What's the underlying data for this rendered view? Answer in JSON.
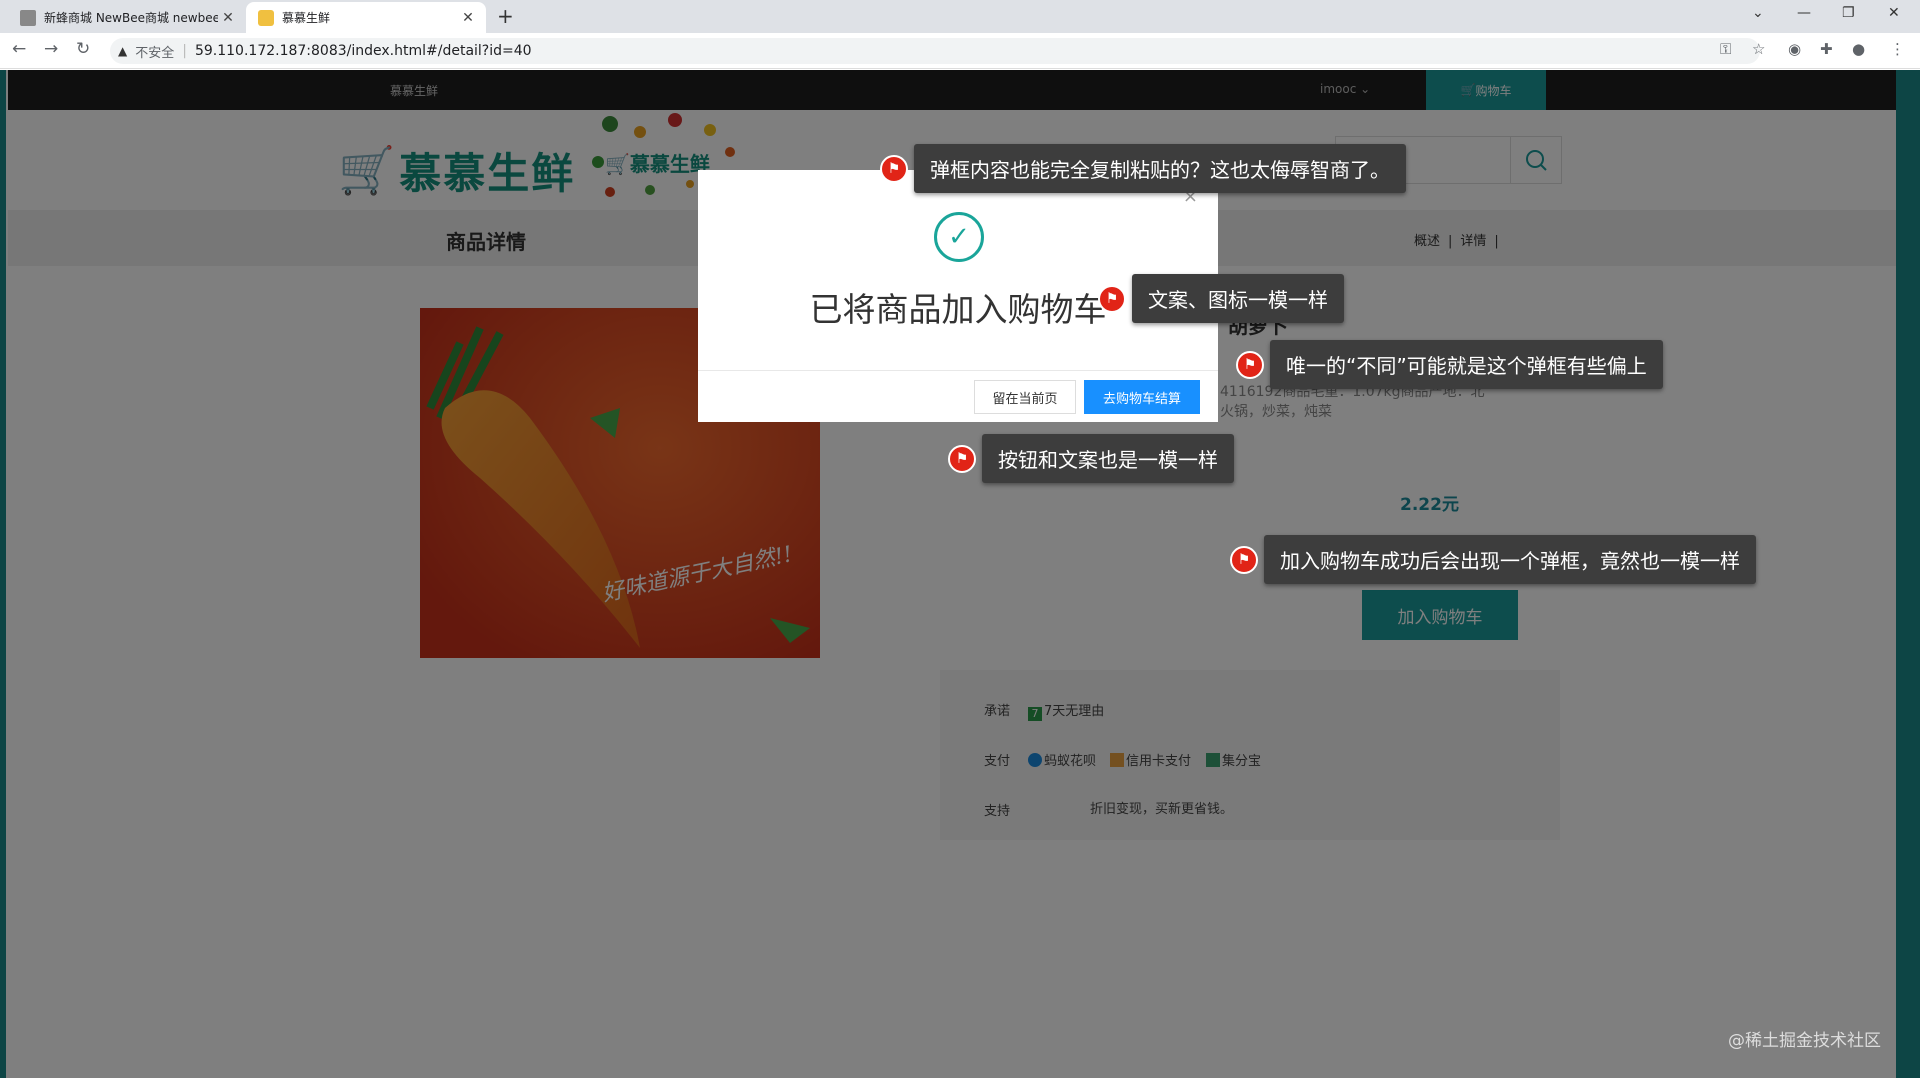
{
  "browser": {
    "tabs": [
      {
        "title": "新蜂商城 NewBee商城 newbee",
        "active": false
      },
      {
        "title": "慕慕生鲜",
        "active": true
      }
    ],
    "security_label": "不安全",
    "url": "59.110.172.187:8083/index.html#/detail?id=40"
  },
  "site": {
    "top_brand": "慕慕生鲜",
    "user_menu": "imooc",
    "cart_link": "购物车",
    "logo_text": "慕慕生鲜",
    "logo_text_small": "慕慕生鲜",
    "accent_color": "#1a9a9a"
  },
  "subnav": {
    "title": "商品详情",
    "links": [
      "概述",
      "详情"
    ]
  },
  "product": {
    "name": "胡萝卜",
    "desc_line1": "4116192商品毛重：1.07kg商品产地：北",
    "desc_line2": "火锅，炒菜，炖菜",
    "price": "2.22元",
    "add_to_cart": "加入购物车",
    "image_caption": "好味道源于大自然!!"
  },
  "services": {
    "promise_label": "承诺",
    "promise_value": "7天无理由",
    "promise_badge": "7",
    "pay_label": "支付",
    "pay_options": [
      "蚂蚁花呗",
      "信用卡支付",
      "集分宝"
    ],
    "support_label": "支持",
    "support_value": "折旧变现，买新更省钱。"
  },
  "modal": {
    "message": "已将商品加入购物车",
    "stay_button": "留在当前页",
    "go_button": "去购物车结算",
    "close": "×"
  },
  "annotations": [
    "弹框内容也能完全复制粘贴的？这也太侮辱智商了。",
    "文案、图标一模一样",
    "唯一的“不同”可能就是这个弹框有些偏上",
    "按钮和文案也是一模一样",
    "加入购物车成功后会出现一个弹框，竟然也一模一样"
  ],
  "watermark": "@稀土掘金技术社区"
}
